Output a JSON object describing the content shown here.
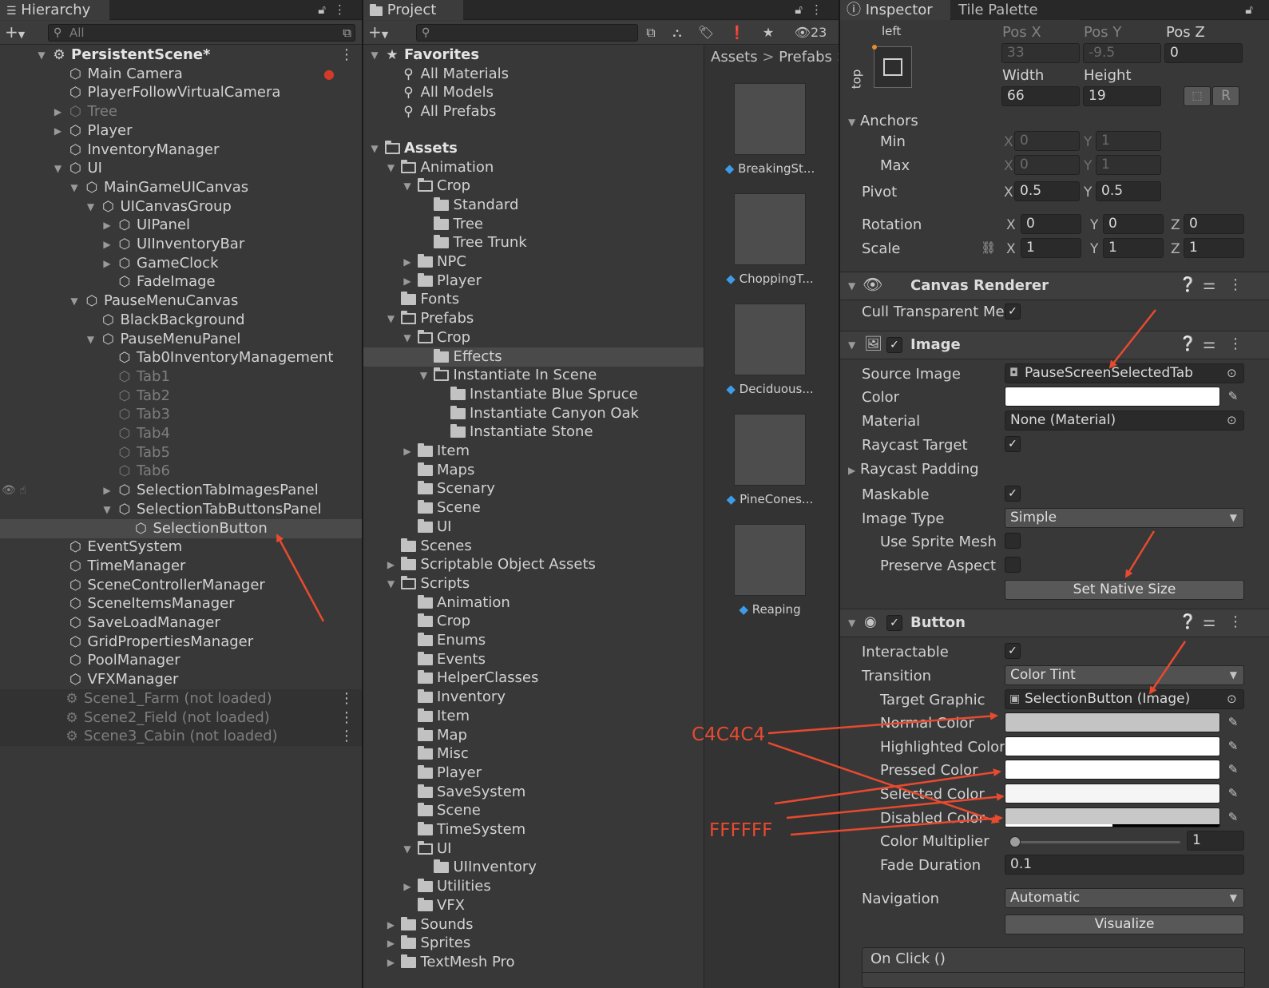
{
  "hierarchy": {
    "tab_label": "Hierarchy",
    "search_placeholder": "All",
    "rows": [
      {
        "label": "PersistentScene*",
        "depth": 0,
        "arrow": "down",
        "icon": "scene",
        "bold": true,
        "kebab": true
      },
      {
        "label": "Main Camera",
        "depth": 1,
        "arrow": "",
        "icon": "cube"
      },
      {
        "label": "PlayerFollowVirtualCamera",
        "depth": 1,
        "arrow": "",
        "icon": "cube"
      },
      {
        "label": "Tree",
        "depth": 1,
        "arrow": "right",
        "icon": "cube",
        "dim": true
      },
      {
        "label": "Player",
        "depth": 1,
        "arrow": "right",
        "icon": "cube"
      },
      {
        "label": "InventoryManager",
        "depth": 1,
        "arrow": "",
        "icon": "cube"
      },
      {
        "label": "UI",
        "depth": 1,
        "arrow": "down",
        "icon": "cube"
      },
      {
        "label": "MainGameUICanvas",
        "depth": 2,
        "arrow": "down",
        "icon": "cube"
      },
      {
        "label": "UICanvasGroup",
        "depth": 3,
        "arrow": "down",
        "icon": "cube"
      },
      {
        "label": "UIPanel",
        "depth": 4,
        "arrow": "right",
        "icon": "cube"
      },
      {
        "label": "UIInventoryBar",
        "depth": 4,
        "arrow": "right",
        "icon": "cube"
      },
      {
        "label": "GameClock",
        "depth": 4,
        "arrow": "right",
        "icon": "cube"
      },
      {
        "label": "FadeImage",
        "depth": 4,
        "arrow": "",
        "icon": "cube"
      },
      {
        "label": "PauseMenuCanvas",
        "depth": 2,
        "arrow": "down",
        "icon": "cube"
      },
      {
        "label": "BlackBackground",
        "depth": 3,
        "arrow": "",
        "icon": "cube"
      },
      {
        "label": "PauseMenuPanel",
        "depth": 3,
        "arrow": "down",
        "icon": "cube"
      },
      {
        "label": "Tab0InventoryManagement",
        "depth": 4,
        "arrow": "",
        "icon": "cube"
      },
      {
        "label": "Tab1",
        "depth": 4,
        "arrow": "",
        "icon": "cube",
        "dim": true
      },
      {
        "label": "Tab2",
        "depth": 4,
        "arrow": "",
        "icon": "cube",
        "dim": true
      },
      {
        "label": "Tab3",
        "depth": 4,
        "arrow": "",
        "icon": "cube",
        "dim": true
      },
      {
        "label": "Tab4",
        "depth": 4,
        "arrow": "",
        "icon": "cube",
        "dim": true
      },
      {
        "label": "Tab5",
        "depth": 4,
        "arrow": "",
        "icon": "cube",
        "dim": true
      },
      {
        "label": "Tab6",
        "depth": 4,
        "arrow": "",
        "icon": "cube",
        "dim": true
      },
      {
        "label": "SelectionTabImagesPanel",
        "depth": 4,
        "arrow": "right",
        "icon": "cube",
        "hovered": true
      },
      {
        "label": "SelectionTabButtonsPanel",
        "depth": 4,
        "arrow": "down",
        "icon": "cube"
      },
      {
        "label": "SelectionButton",
        "depth": 5,
        "arrow": "",
        "icon": "cube",
        "selected": true
      },
      {
        "label": "EventSystem",
        "depth": 1,
        "arrow": "",
        "icon": "cube"
      },
      {
        "label": "TimeManager",
        "depth": 1,
        "arrow": "",
        "icon": "cube"
      },
      {
        "label": "SceneControllerManager",
        "depth": 1,
        "arrow": "",
        "icon": "cube"
      },
      {
        "label": "SceneItemsManager",
        "depth": 1,
        "arrow": "",
        "icon": "cube"
      },
      {
        "label": "SaveLoadManager",
        "depth": 1,
        "arrow": "",
        "icon": "cube"
      },
      {
        "label": "GridPropertiesManager",
        "depth": 1,
        "arrow": "",
        "icon": "cube"
      },
      {
        "label": "PoolManager",
        "depth": 1,
        "arrow": "",
        "icon": "cube"
      },
      {
        "label": "VFXManager",
        "depth": 1,
        "arrow": "",
        "icon": "cube"
      },
      {
        "label": "Scene1_Farm (not loaded)",
        "depth": 0,
        "arrow": "",
        "icon": "scene",
        "dim": true,
        "scene": true,
        "kebab": true
      },
      {
        "label": "Scene2_Field (not loaded)",
        "depth": 0,
        "arrow": "",
        "icon": "scene",
        "dim": true,
        "scene": true,
        "kebab": true
      },
      {
        "label": "Scene3_Cabin (not loaded)",
        "depth": 0,
        "arrow": "",
        "icon": "scene",
        "dim": true,
        "scene": true,
        "kebab": true
      }
    ]
  },
  "project": {
    "tab_label": "Project",
    "hidden_count": "23",
    "breadcrumb": [
      "Assets",
      "Prefabs"
    ],
    "tree": [
      {
        "label": "Favorites",
        "depth": 0,
        "arrow": "down",
        "icon": "star",
        "bold": true
      },
      {
        "label": "All Materials",
        "depth": 1,
        "arrow": "",
        "icon": "search"
      },
      {
        "label": "All Models",
        "depth": 1,
        "arrow": "",
        "icon": "search"
      },
      {
        "label": "All Prefabs",
        "depth": 1,
        "arrow": "",
        "icon": "search"
      },
      {
        "label": "",
        "depth": 0,
        "arrow": "",
        "icon": "",
        "spacer": true
      },
      {
        "label": "Assets",
        "depth": 0,
        "arrow": "down",
        "icon": "folder-open",
        "bold": true
      },
      {
        "label": "Animation",
        "depth": 1,
        "arrow": "down",
        "icon": "folder-open"
      },
      {
        "label": "Crop",
        "depth": 2,
        "arrow": "down",
        "icon": "folder-open"
      },
      {
        "label": "Standard",
        "depth": 3,
        "arrow": "",
        "icon": "folder"
      },
      {
        "label": "Tree",
        "depth": 3,
        "arrow": "",
        "icon": "folder"
      },
      {
        "label": "Tree Trunk",
        "depth": 3,
        "arrow": "",
        "icon": "folder"
      },
      {
        "label": "NPC",
        "depth": 2,
        "arrow": "right",
        "icon": "folder"
      },
      {
        "label": "Player",
        "depth": 2,
        "arrow": "right",
        "icon": "folder"
      },
      {
        "label": "Fonts",
        "depth": 1,
        "arrow": "",
        "icon": "folder"
      },
      {
        "label": "Prefabs",
        "depth": 1,
        "arrow": "down",
        "icon": "folder-open"
      },
      {
        "label": "Crop",
        "depth": 2,
        "arrow": "down",
        "icon": "folder-open"
      },
      {
        "label": "Effects",
        "depth": 3,
        "arrow": "",
        "icon": "folder",
        "selected": true
      },
      {
        "label": "Instantiate In Scene",
        "depth": 3,
        "arrow": "down",
        "icon": "folder-open"
      },
      {
        "label": "Instantiate Blue Spruce",
        "depth": 4,
        "arrow": "",
        "icon": "folder"
      },
      {
        "label": "Instantiate Canyon Oak",
        "depth": 4,
        "arrow": "",
        "icon": "folder"
      },
      {
        "label": "Instantiate Stone",
        "depth": 4,
        "arrow": "",
        "icon": "folder"
      },
      {
        "label": "Item",
        "depth": 2,
        "arrow": "right",
        "icon": "folder"
      },
      {
        "label": "Maps",
        "depth": 2,
        "arrow": "",
        "icon": "folder"
      },
      {
        "label": "Scenary",
        "depth": 2,
        "arrow": "",
        "icon": "folder"
      },
      {
        "label": "Scene",
        "depth": 2,
        "arrow": "",
        "icon": "folder"
      },
      {
        "label": "UI",
        "depth": 2,
        "arrow": "",
        "icon": "folder"
      },
      {
        "label": "Scenes",
        "depth": 1,
        "arrow": "",
        "icon": "folder"
      },
      {
        "label": "Scriptable Object Assets",
        "depth": 1,
        "arrow": "right",
        "icon": "folder"
      },
      {
        "label": "Scripts",
        "depth": 1,
        "arrow": "down",
        "icon": "folder-open"
      },
      {
        "label": "Animation",
        "depth": 2,
        "arrow": "",
        "icon": "folder"
      },
      {
        "label": "Crop",
        "depth": 2,
        "arrow": "",
        "icon": "folder"
      },
      {
        "label": "Enums",
        "depth": 2,
        "arrow": "",
        "icon": "folder"
      },
      {
        "label": "Events",
        "depth": 2,
        "arrow": "",
        "icon": "folder"
      },
      {
        "label": "HelperClasses",
        "depth": 2,
        "arrow": "",
        "icon": "folder"
      },
      {
        "label": "Inventory",
        "depth": 2,
        "arrow": "",
        "icon": "folder"
      },
      {
        "label": "Item",
        "depth": 2,
        "arrow": "",
        "icon": "folder"
      },
      {
        "label": "Map",
        "depth": 2,
        "arrow": "",
        "icon": "folder"
      },
      {
        "label": "Misc",
        "depth": 2,
        "arrow": "",
        "icon": "folder"
      },
      {
        "label": "Player",
        "depth": 2,
        "arrow": "",
        "icon": "folder"
      },
      {
        "label": "SaveSystem",
        "depth": 2,
        "arrow": "",
        "icon": "folder"
      },
      {
        "label": "Scene",
        "depth": 2,
        "arrow": "",
        "icon": "folder"
      },
      {
        "label": "TimeSystem",
        "depth": 2,
        "arrow": "",
        "icon": "folder"
      },
      {
        "label": "UI",
        "depth": 2,
        "arrow": "down",
        "icon": "folder-open"
      },
      {
        "label": "UIInventory",
        "depth": 3,
        "arrow": "",
        "icon": "folder"
      },
      {
        "label": "Utilities",
        "depth": 2,
        "arrow": "right",
        "icon": "folder"
      },
      {
        "label": "VFX",
        "depth": 2,
        "arrow": "",
        "icon": "folder"
      },
      {
        "label": "Sounds",
        "depth": 1,
        "arrow": "right",
        "icon": "folder"
      },
      {
        "label": "Sprites",
        "depth": 1,
        "arrow": "right",
        "icon": "folder"
      },
      {
        "label": "TextMesh Pro",
        "depth": 1,
        "arrow": "right",
        "icon": "folder"
      }
    ],
    "assets": [
      "BreakingSt...",
      "ChoppingT...",
      "Deciduous...",
      "PineCones...",
      "Reaping"
    ]
  },
  "inspector": {
    "tab_label": "Inspector",
    "tab2_label": "Tile Palette",
    "rect": {
      "anchor_left": "left",
      "anchor_top": "top",
      "posx_label": "Pos X",
      "posx": "33",
      "posy_label": "Pos Y",
      "posy": "-9.5",
      "posz_label": "Pos Z",
      "posz": "0",
      "width_label": "Width",
      "width": "66",
      "height_label": "Height",
      "height": "19",
      "r_btn": "R",
      "anchors_label": "Anchors",
      "min_label": "Min",
      "min_x": "0",
      "min_y": "1",
      "max_label": "Max",
      "max_x": "0",
      "max_y": "1",
      "pivot_label": "Pivot",
      "pivot_x": "0.5",
      "pivot_y": "0.5",
      "rotation_label": "Rotation",
      "rot_x": "0",
      "rot_y": "0",
      "rot_z": "0",
      "scale_label": "Scale",
      "scale_x": "1",
      "scale_y": "1",
      "scale_z": "1",
      "x": "X",
      "y": "Y",
      "z": "Z"
    },
    "canvas_renderer": {
      "title": "Canvas Renderer",
      "cull_label": "Cull Transparent Me"
    },
    "image": {
      "title": "Image",
      "source_label": "Source Image",
      "source_value": "PauseScreenSelectedTab",
      "color_label": "Color",
      "material_label": "Material",
      "material_value": "None (Material)",
      "raycast_label": "Raycast Target",
      "padding_label": "Raycast Padding",
      "maskable_label": "Maskable",
      "type_label": "Image Type",
      "type_value": "Simple",
      "sprite_mesh_label": "Use Sprite Mesh",
      "preserve_label": "Preserve Aspect",
      "native_btn": "Set Native Size",
      "color_hex": "#FFFFFF"
    },
    "button": {
      "title": "Button",
      "interactable_label": "Interactable",
      "transition_label": "Transition",
      "transition_value": "Color Tint",
      "target_label": "Target Graphic",
      "target_value": "SelectionButton (Image)",
      "normal_label": "Normal Color",
      "normal_hex": "#C4C4C4",
      "highlighted_label": "Highlighted Color",
      "highlighted_hex": "#FFFFFF",
      "pressed_label": "Pressed Color",
      "pressed_hex": "#FFFFFF",
      "selected_label": "Selected Color",
      "selected_hex": "#F5F5F5",
      "disabled_label": "Disabled Color",
      "disabled_hex": "#C8C8C8",
      "multiplier_label": "Color Multiplier",
      "multiplier_value": "1",
      "multiplier_fraction": 0,
      "fade_label": "Fade Duration",
      "fade_value": "0.1",
      "nav_label": "Navigation",
      "nav_value": "Automatic",
      "visualize_btn": "Visualize",
      "onclick_label": "On Click ()"
    }
  },
  "annotations": {
    "c4": "C4C4C4",
    "ff": "FFFFFF",
    "color": "#E84A2F"
  }
}
